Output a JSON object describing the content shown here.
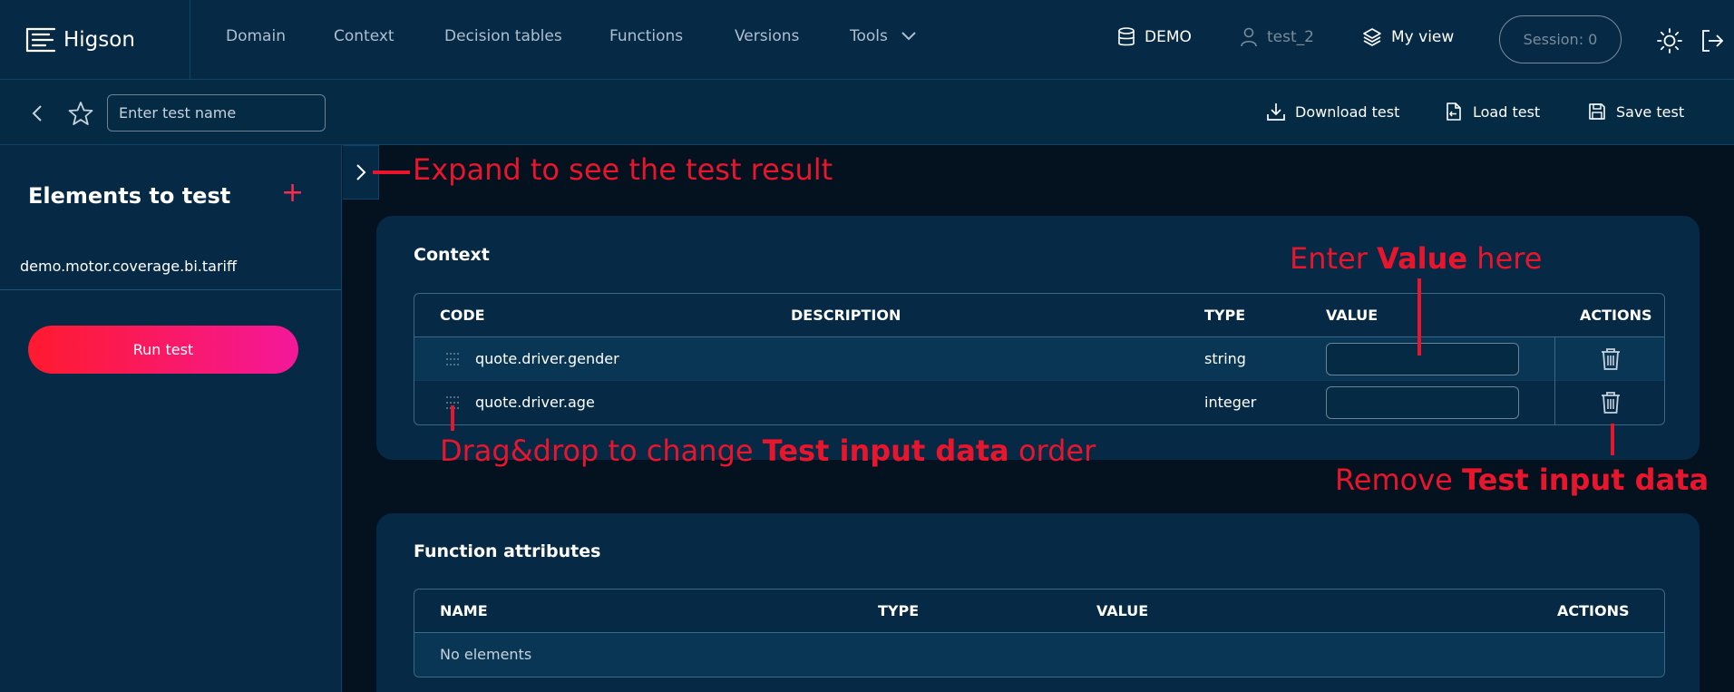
{
  "app": {
    "logo_text": "Higson"
  },
  "nav": {
    "items": [
      "Domain",
      "Context",
      "Decision tables",
      "Functions",
      "Versions",
      "Tools"
    ],
    "environment": "DEMO",
    "user": "test_2",
    "view": "My view",
    "session": "Session: 0"
  },
  "toolbar": {
    "test_name_placeholder": "Enter test name",
    "download_label": "Download test",
    "load_label": "Load test",
    "save_label": "Save test"
  },
  "sidebar": {
    "title": "Elements to test",
    "items": [
      "demo.motor.coverage.bi.tariff"
    ],
    "run_button": "Run test"
  },
  "context": {
    "title": "Context",
    "columns": [
      "CODE",
      "DESCRIPTION",
      "TYPE",
      "VALUE",
      "ACTIONS"
    ],
    "rows": [
      {
        "code": "quote.driver.gender",
        "description": "",
        "type": "string",
        "value": ""
      },
      {
        "code": "quote.driver.age",
        "description": "",
        "type": "integer",
        "value": ""
      }
    ]
  },
  "function_attributes": {
    "title": "Function attributes",
    "columns": [
      "NAME",
      "TYPE",
      "VALUE",
      "ACTIONS"
    ],
    "empty_text": "No elements"
  },
  "annotations": {
    "expand": "Expand to see the test result",
    "enter_value_pre": "Enter ",
    "enter_value_bold": "Value",
    "enter_value_post": " here",
    "drag_pre": "Drag&drop to change ",
    "drag_bold": "Test input data",
    "drag_post": " order",
    "remove_pre": "Remove ",
    "remove_bold": "Test input data"
  },
  "colors": {
    "nav_bg": "#062a45",
    "content_bg": "#04121f",
    "accent": "#ff2a4d",
    "annotation": "#e8152c",
    "run_gradient_start": "#ff1a2e",
    "run_gradient_end": "#f4189a"
  }
}
